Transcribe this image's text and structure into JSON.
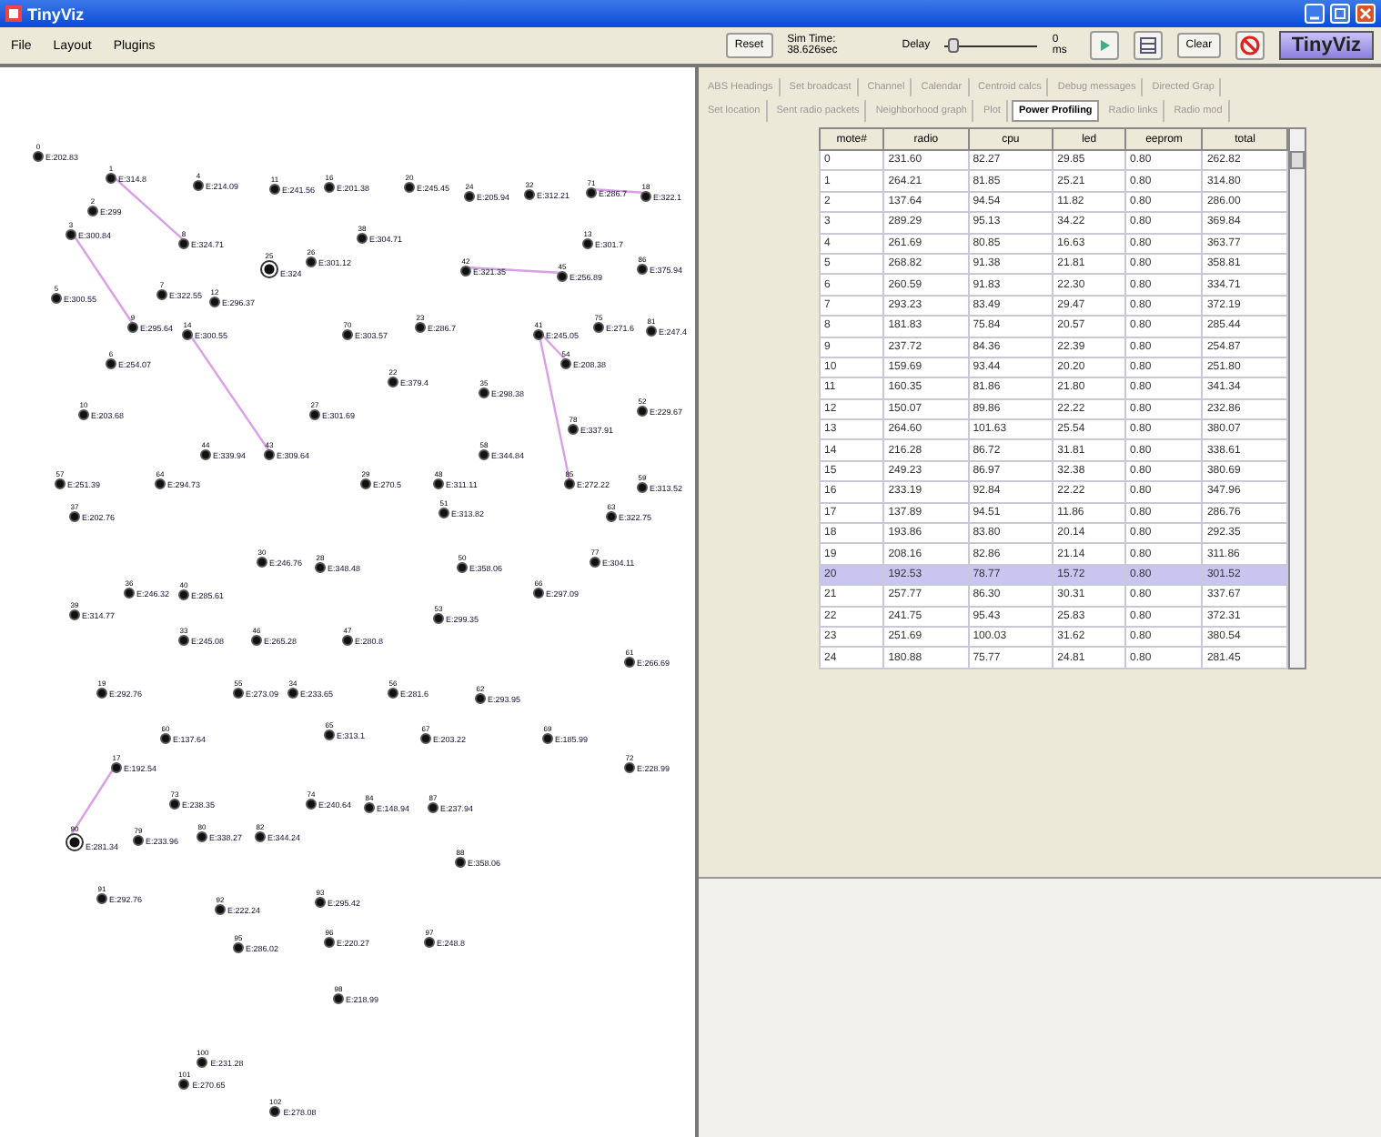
{
  "window": {
    "title": "TinyViz"
  },
  "menu": [
    "File",
    "Layout",
    "Plugins"
  ],
  "toolbar": {
    "reset": "Reset",
    "sim_time": "Sim Time: 38.626sec",
    "delay_label": "Delay",
    "delay": {
      "level": 0.05
    },
    "delay_reading": "0 ms",
    "clear": "Clear",
    "logo": "TinyViz"
  },
  "nodes": [
    {
      "id": "0",
      "energy": "E:202.83",
      "selected": false
    },
    {
      "id": "1",
      "energy": "E:314.8",
      "selected": false
    },
    {
      "id": "4",
      "energy": "E:214.09",
      "selected": false
    },
    {
      "id": "11",
      "energy": "E:241.56",
      "selected": false
    },
    {
      "id": "16",
      "energy": "E:201.38",
      "selected": false
    },
    {
      "id": "20",
      "energy": "E:245.45",
      "selected": false
    },
    {
      "id": "24",
      "energy": "E:205.94",
      "selected": false
    },
    {
      "id": "32",
      "energy": "E:312.21",
      "selected": false
    },
    {
      "id": "71",
      "energy": "E:286.7",
      "selected": false
    },
    {
      "id": "18",
      "energy": "E:322.1",
      "selected": false
    },
    {
      "id": "2",
      "energy": "E:299",
      "selected": false
    },
    {
      "id": "3",
      "energy": "E:300.84",
      "selected": false
    },
    {
      "id": "8",
      "energy": "E:324.71",
      "selected": false
    },
    {
      "id": "38",
      "energy": "E:304.71",
      "selected": false
    },
    {
      "id": "13",
      "energy": "E:301.7",
      "selected": false
    },
    {
      "id": "25",
      "energy": "E:324",
      "selected": true
    },
    {
      "id": "26",
      "energy": "E:301.12",
      "selected": false
    },
    {
      "id": "42",
      "energy": "E:321.35",
      "selected": false
    },
    {
      "id": "45",
      "energy": "E:256.89",
      "selected": false
    },
    {
      "id": "86",
      "energy": "E:375.94",
      "selected": false
    },
    {
      "id": "5",
      "energy": "E:300.55",
      "selected": false
    },
    {
      "id": "7",
      "energy": "E:322.55",
      "selected": false
    },
    {
      "id": "12",
      "energy": "E:296.37",
      "selected": false
    },
    {
      "id": "9",
      "energy": "E:295.64",
      "selected": false
    },
    {
      "id": "14",
      "energy": "E:300.55",
      "selected": false
    },
    {
      "id": "70",
      "energy": "E:303.57",
      "selected": false
    },
    {
      "id": "23",
      "energy": "E:286.7",
      "selected": false
    },
    {
      "id": "41",
      "energy": "E:245.05",
      "selected": false
    },
    {
      "id": "75",
      "energy": "E:271.6",
      "selected": false
    },
    {
      "id": "81",
      "energy": "E:247.4",
      "selected": false
    },
    {
      "id": "6",
      "energy": "E:254.07",
      "selected": false
    },
    {
      "id": "54",
      "energy": "E:208.38",
      "selected": false
    },
    {
      "id": "22",
      "energy": "E:379.4",
      "selected": false
    },
    {
      "id": "35",
      "energy": "E:298.38",
      "selected": false
    },
    {
      "id": "10",
      "energy": "E:203.68",
      "selected": false
    },
    {
      "id": "27",
      "energy": "E:301.69",
      "selected": false
    },
    {
      "id": "52",
      "energy": "E:229.67",
      "selected": false
    },
    {
      "id": "78",
      "energy": "E:337.91",
      "selected": false
    },
    {
      "id": "44",
      "energy": "E:339.94",
      "selected": false
    },
    {
      "id": "43",
      "energy": "E:309.64",
      "selected": false
    },
    {
      "id": "58",
      "energy": "E:344.84",
      "selected": false
    },
    {
      "id": "57",
      "energy": "E:251.39",
      "selected": false
    },
    {
      "id": "64",
      "energy": "E:294.73",
      "selected": false
    },
    {
      "id": "29",
      "energy": "E:270.5",
      "selected": false
    },
    {
      "id": "48",
      "energy": "E:311.11",
      "selected": false
    },
    {
      "id": "85",
      "energy": "E:272.22",
      "selected": false
    },
    {
      "id": "59",
      "energy": "E:313.52",
      "selected": false
    },
    {
      "id": "37",
      "energy": "E:202.76",
      "selected": false
    },
    {
      "id": "51",
      "energy": "E:313.82",
      "selected": false
    },
    {
      "id": "63",
      "energy": "E:322.75",
      "selected": false
    },
    {
      "id": "30",
      "energy": "E:246.76",
      "selected": false
    },
    {
      "id": "28",
      "energy": "E:348.48",
      "selected": false
    },
    {
      "id": "50",
      "energy": "E:358.06",
      "selected": false
    },
    {
      "id": "77",
      "energy": "E:304.11",
      "selected": false
    },
    {
      "id": "36",
      "energy": "E:246.32",
      "selected": false
    },
    {
      "id": "40",
      "energy": "E:285.61",
      "selected": false
    },
    {
      "id": "66",
      "energy": "E:297.09",
      "selected": false
    },
    {
      "id": "39",
      "energy": "E:314.77",
      "selected": false
    },
    {
      "id": "53",
      "energy": "E:299.35",
      "selected": false
    },
    {
      "id": "33",
      "energy": "E:245.08",
      "selected": false
    },
    {
      "id": "46",
      "energy": "E:265.28",
      "selected": false
    },
    {
      "id": "47",
      "energy": "E:280.8",
      "selected": false
    },
    {
      "id": "61",
      "energy": "E:266.69",
      "selected": false
    },
    {
      "id": "19",
      "energy": "E:292.76",
      "selected": false
    },
    {
      "id": "55",
      "energy": "E:273.09",
      "selected": false
    },
    {
      "id": "34",
      "energy": "E:233.65",
      "selected": false
    },
    {
      "id": "56",
      "energy": "E:281.6",
      "selected": false
    },
    {
      "id": "62",
      "energy": "E:293.95",
      "selected": false
    },
    {
      "id": "60",
      "energy": "E:137.64",
      "selected": false
    },
    {
      "id": "65",
      "energy": "E:313.1",
      "selected": false
    },
    {
      "id": "67",
      "energy": "E:203.22",
      "selected": false
    },
    {
      "id": "69",
      "energy": "E:185.99",
      "selected": false
    },
    {
      "id": "17",
      "energy": "E:192.54",
      "selected": false
    },
    {
      "id": "72",
      "energy": "E:228.99",
      "selected": false
    },
    {
      "id": "73",
      "energy": "E:238.35",
      "selected": false
    },
    {
      "id": "74",
      "energy": "E:240.64",
      "selected": false
    },
    {
      "id": "84",
      "energy": "E:148.94",
      "selected": false
    },
    {
      "id": "87",
      "energy": "E:237.94",
      "selected": false
    },
    {
      "id": "90",
      "energy": "E:281.34",
      "selected": true
    },
    {
      "id": "79",
      "energy": "E:233.96",
      "selected": false
    },
    {
      "id": "80",
      "energy": "E:338.27",
      "selected": false
    },
    {
      "id": "82",
      "energy": "E:344.24",
      "selected": false
    },
    {
      "id": "88",
      "energy": "E:358.06",
      "selected": false
    },
    {
      "id": "91",
      "energy": "E:292.76",
      "selected": false
    },
    {
      "id": "92",
      "energy": "E:222.24",
      "selected": false
    },
    {
      "id": "93",
      "energy": "E:295.42",
      "selected": false
    },
    {
      "id": "95",
      "energy": "E:286.02",
      "selected": false
    },
    {
      "id": "96",
      "energy": "E:220.27",
      "selected": false
    },
    {
      "id": "97",
      "energy": "E:248.8",
      "selected": false
    },
    {
      "id": "98",
      "energy": "E:218.99",
      "selected": false
    },
    {
      "id": "100",
      "energy": "E:231.28",
      "selected": false
    },
    {
      "id": "101",
      "energy": "E:270.65",
      "selected": false
    },
    {
      "id": "102",
      "energy": "E:278.08",
      "selected": false
    }
  ],
  "tabs": [
    [
      {
        "label": "ABS Headings",
        "selected": false
      },
      {
        "label": "Set broadcast",
        "selected": false
      },
      {
        "label": "Channel",
        "selected": false
      },
      {
        "label": "Calendar",
        "selected": false
      },
      {
        "label": "Centroid calcs",
        "selected": false
      },
      {
        "label": "Debug messages",
        "selected": false
      },
      {
        "label": "Directed Grap",
        "selected": false
      }
    ],
    [
      {
        "label": "Set location",
        "selected": false
      },
      {
        "label": "Sent radio packets",
        "selected": false
      },
      {
        "label": "Neighborhood graph",
        "selected": false
      },
      {
        "label": "Plot",
        "selected": false
      },
      {
        "label": "Power Profiling",
        "selected": true
      },
      {
        "label": "Radio links",
        "selected": false
      },
      {
        "label": "Radio mod",
        "selected": false
      }
    ]
  ],
  "table": {
    "columns": [
      "mote#",
      "radio",
      "cpu",
      "led",
      "eeprom",
      "total"
    ],
    "rows": [
      {
        "cells": [
          "0",
          "231.60",
          "82.27",
          "29.85",
          "0.80",
          "262.82"
        ],
        "selected": false
      },
      {
        "cells": [
          "1",
          "264.21",
          "81.85",
          "25.21",
          "0.80",
          "314.80"
        ],
        "selected": false
      },
      {
        "cells": [
          "2",
          "137.64",
          "94.54",
          "11.82",
          "0.80",
          "286.00"
        ],
        "selected": false
      },
      {
        "cells": [
          "3",
          "289.29",
          "95.13",
          "34.22",
          "0.80",
          "369.84"
        ],
        "selected": false
      },
      {
        "cells": [
          "4",
          "261.69",
          "80.85",
          "16.63",
          "0.80",
          "363.77"
        ],
        "selected": false
      },
      {
        "cells": [
          "5",
          "268.82",
          "91.38",
          "21.81",
          "0.80",
          "358.81"
        ],
        "selected": false
      },
      {
        "cells": [
          "6",
          "260.59",
          "91.83",
          "22.30",
          "0.80",
          "334.71"
        ],
        "selected": false
      },
      {
        "cells": [
          "7",
          "293.23",
          "83.49",
          "29.47",
          "0.80",
          "372.19"
        ],
        "selected": false
      },
      {
        "cells": [
          "8",
          "181.83",
          "75.84",
          "20.57",
          "0.80",
          "285.44"
        ],
        "selected": false
      },
      {
        "cells": [
          "9",
          "237.72",
          "84.36",
          "22.39",
          "0.80",
          "254.87"
        ],
        "selected": false
      },
      {
        "cells": [
          "10",
          "159.69",
          "93.44",
          "20.20",
          "0.80",
          "251.80"
        ],
        "selected": false
      },
      {
        "cells": [
          "11",
          "160.35",
          "81.86",
          "21.80",
          "0.80",
          "341.34"
        ],
        "selected": false
      },
      {
        "cells": [
          "12",
          "150.07",
          "89.86",
          "22.22",
          "0.80",
          "232.86"
        ],
        "selected": false
      },
      {
        "cells": [
          "13",
          "264.60",
          "101.63",
          "25.54",
          "0.80",
          "380.07"
        ],
        "selected": false
      },
      {
        "cells": [
          "14",
          "216.28",
          "86.72",
          "31.81",
          "0.80",
          "338.61"
        ],
        "selected": false
      },
      {
        "cells": [
          "15",
          "249.23",
          "86.97",
          "32.38",
          "0.80",
          "380.69"
        ],
        "selected": false
      },
      {
        "cells": [
          "16",
          "233.19",
          "92.84",
          "22.22",
          "0.80",
          "347.96"
        ],
        "selected": false
      },
      {
        "cells": [
          "17",
          "137.89",
          "94.51",
          "11.86",
          "0.80",
          "286.76"
        ],
        "selected": false
      },
      {
        "cells": [
          "18",
          "193.86",
          "83.80",
          "20.14",
          "0.80",
          "292.35"
        ],
        "selected": false
      },
      {
        "cells": [
          "19",
          "208.16",
          "82.86",
          "21.14",
          "0.80",
          "311.86"
        ],
        "selected": false
      },
      {
        "cells": [
          "20",
          "192.53",
          "78.77",
          "15.72",
          "0.80",
          "301.52"
        ],
        "selected": true
      },
      {
        "cells": [
          "21",
          "257.77",
          "86.30",
          "30.31",
          "0.80",
          "337.67"
        ],
        "selected": false
      },
      {
        "cells": [
          "22",
          "241.75",
          "95.43",
          "25.83",
          "0.80",
          "372.31"
        ],
        "selected": false
      },
      {
        "cells": [
          "23",
          "251.69",
          "100.03",
          "31.62",
          "0.80",
          "380.54"
        ],
        "selected": false
      },
      {
        "cells": [
          "24",
          "180.88",
          "75.77",
          "24.81",
          "0.80",
          "281.45"
        ],
        "selected": false
      }
    ]
  }
}
